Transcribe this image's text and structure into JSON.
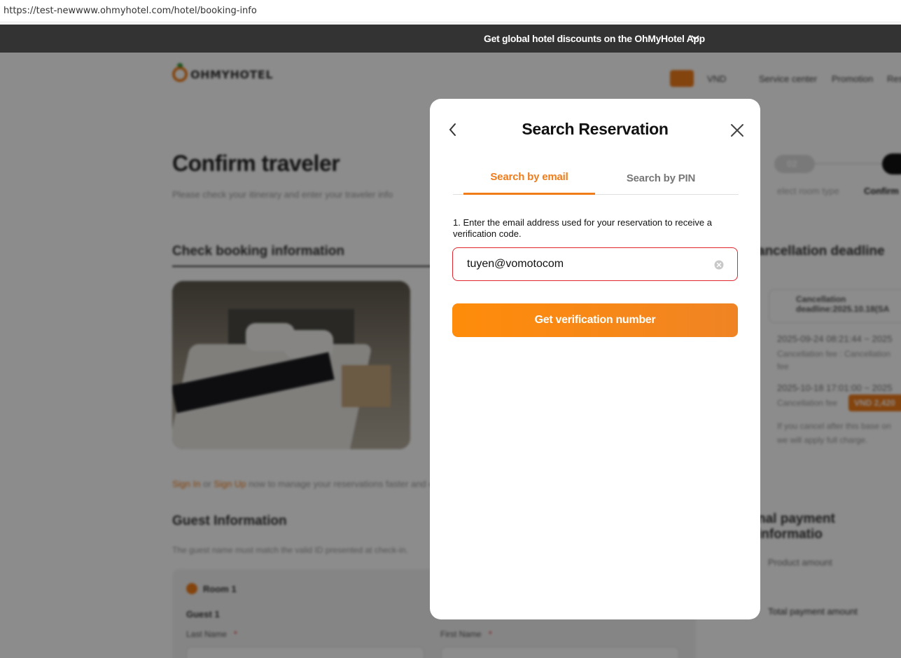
{
  "browser": {
    "url": "https://test-newwww.ohmyhotel.com/hotel/booking-info"
  },
  "promo_bar": {
    "text": "Get global hotel discounts on the OhMyHotel App"
  },
  "background": {
    "logo_text": "OHMYHOTEL",
    "nav": {
      "currency": "VND",
      "service_center": "Service center",
      "promotion": "Promotion",
      "reservation": "Res"
    },
    "page_title": "Confirm traveler",
    "page_subtitle": "Please check your itinerary and enter your traveler info",
    "steps": {
      "step2_num": "02",
      "step2_label": "elect room type",
      "step3_label": "Confirm"
    },
    "check_booking_title": "Check booking information",
    "cancellation_title": "ancellation deadline",
    "cancellation_box": "Cancellation deadline:2025.10.18(SA",
    "policy": [
      "2025-09-24 08:21:44 ~ 2025",
      "Cancellation fee : Cancellation",
      "fee",
      "2025-10-18 17:01:00 ~ 2025",
      "Cancellation fee",
      "If you cancel after this base on",
      "we will apply full charge."
    ],
    "policy_badge": "VND 2,420",
    "signin_note": {
      "sign_in": "Sign In",
      "or": " or ",
      "sign_up": "Sign Up",
      "rest": " now to manage your reservations faster and e"
    },
    "guest_info_title": "Guest Information",
    "guest_info_sub": "The guest name must match the valid ID presented at check-in.",
    "room_label": "Room 1",
    "guest_label": "Guest 1",
    "last_name_label": "Last Name",
    "first_name_label": "First Name",
    "final_payment_title": "nal payment informatio",
    "product_amount": "Product amount",
    "total_payment": "Total payment amount"
  },
  "modal": {
    "title": "Search Reservation",
    "tabs": [
      {
        "label": "Search by email",
        "active": true
      },
      {
        "label": "Search by PIN",
        "active": false
      }
    ],
    "instruction": "1. Enter the email address used for your reservation to receive a verification code.",
    "email_value": "tuyen@vomotocom",
    "submit_label": "Get verification number"
  },
  "colors": {
    "brand_orange": "#f07c1a",
    "error_red": "#e0262f",
    "promo_bg": "#333333"
  }
}
